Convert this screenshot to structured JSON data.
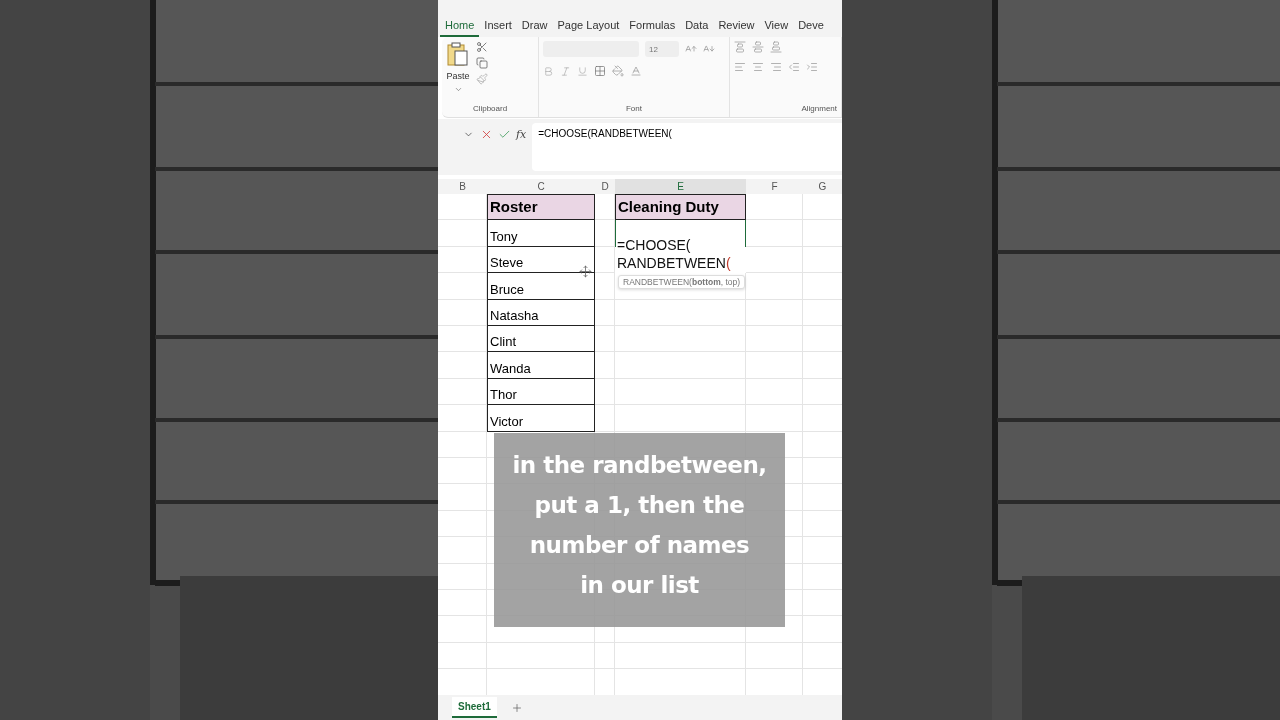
{
  "ribbon_tabs": [
    {
      "label": "Home",
      "selected": true
    },
    {
      "label": "Insert",
      "selected": false
    },
    {
      "label": "Draw",
      "selected": false
    },
    {
      "label": "Page Layout",
      "selected": false
    },
    {
      "label": "Formulas",
      "selected": false
    },
    {
      "label": "Data",
      "selected": false
    },
    {
      "label": "Review",
      "selected": false
    },
    {
      "label": "View",
      "selected": false
    },
    {
      "label": "Deve",
      "selected": false
    }
  ],
  "ribbon": {
    "paste_label": "Paste",
    "clipboard_label": "Clipboard",
    "font_size": "12",
    "font_label": "Font",
    "alignment_label": "Alignment"
  },
  "formula_bar": {
    "fx_label": "fx",
    "value": "=CHOOSE(RANDBETWEEN("
  },
  "columns": [
    {
      "label": "B",
      "selected": false
    },
    {
      "label": "C",
      "selected": false
    },
    {
      "label": "D",
      "selected": false
    },
    {
      "label": "E",
      "selected": true
    },
    {
      "label": "F",
      "selected": false
    },
    {
      "label": "G",
      "selected": false
    }
  ],
  "roster": {
    "header": "Roster",
    "names": [
      "Tony",
      "Steve",
      "Bruce",
      "Natasha",
      "Clint",
      "Wanda",
      "Thor",
      "Victor"
    ]
  },
  "duty": {
    "header": "Cleaning Duty",
    "editing_lines": [
      "=CHOOSE(",
      "RANDBETWEEN("
    ],
    "tooltip": "RANDBETWEEN(**bottom**, top)"
  },
  "caption": [
    "in the randbetween,",
    "put a 1, then the",
    "number of names",
    "in our list"
  ],
  "sheet_tabs": [
    {
      "label": "Sheet1",
      "selected": true
    }
  ]
}
